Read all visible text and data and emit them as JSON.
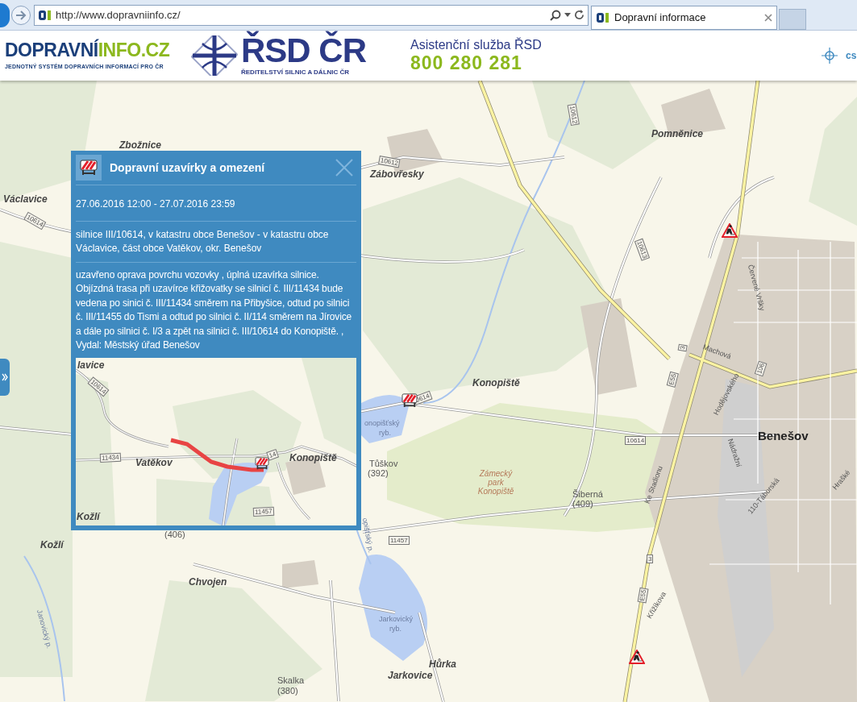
{
  "browser": {
    "address": "http://www.dopravniinfo.cz/",
    "tab_title": "Dopravní informace"
  },
  "header": {
    "logo_dark": "DOPRAVNÍ",
    "logo_light": "INFO.CZ",
    "logo_tagline": "JEDNOTNÝ SYSTÉM DOPRAVNÍCH INFORMACÍ PRO ČR",
    "rsd_title": "ŘSD ČR",
    "rsd_subtitle": "ŘEDITELSTVÍ SILNIC A DÁLNIC ČR",
    "assistance_label": "Asistenční služba ŘSD",
    "assistance_phone": "800 280 281",
    "language": "cs"
  },
  "popup": {
    "title": "Dopravní uzavírky a omezení",
    "date_range": "27.06.2016 12:00 - 27.07.2016 23:59",
    "location": "silnice III/10614, v katastru obce Benešov - v katastru obce Václavice, část obce Vatěkov, okr. Benešov",
    "description": "uzavřeno oprava povrchu vozovky , úplná uzavírka silnice. Objízdná trasa při uzavírce křižovatky se silnicí č. III/11434 bude vedena po sinici č. III/11434 směrem na Přibyšice, odtud po silnici č. III/11455 do Tismi a odtud po silnici č. II/114 směrem na Jírovice a dále po silnici č. I/3 a zpět na silnici č. III/10614 do Konopiště. , Vydal: Městský úřad Benešov",
    "inset_labels": [
      {
        "text": "lavice",
        "kind": "village"
      },
      {
        "text": "10614",
        "kind": "road"
      },
      {
        "text": "11434",
        "kind": "road"
      },
      {
        "text": "Vatěkov",
        "kind": "village"
      },
      {
        "text": "14",
        "kind": "road"
      },
      {
        "text": "Konopiště",
        "kind": "village"
      },
      {
        "text": "Kožlí",
        "kind": "village"
      },
      {
        "text": "11457",
        "kind": "road"
      }
    ]
  },
  "map_labels": [
    {
      "text": "Zbožnice",
      "kind": "village"
    },
    {
      "text": "Václavice",
      "kind": "village"
    },
    {
      "text": "10614",
      "kind": "road"
    },
    {
      "text": "Zábovřesky",
      "kind": "village"
    },
    {
      "text": "10612",
      "kind": "road"
    },
    {
      "text": "10612",
      "kind": "road"
    },
    {
      "text": "Pomněnice",
      "kind": "village"
    },
    {
      "text": "10613",
      "kind": "road"
    },
    {
      "text": "Konopiště",
      "kind": "village"
    },
    {
      "text": "0614",
      "kind": "road"
    },
    {
      "text": "onopišťský",
      "kind": "water"
    },
    {
      "text": "ryb.",
      "kind": "water"
    },
    {
      "text": "Tůškov",
      "kind": "peak"
    },
    {
      "text": "(392)",
      "kind": "peak"
    },
    {
      "text": "Zámecký park Konopiště",
      "kind": "park"
    },
    {
      "text": "Šiberná",
      "kind": "peak"
    },
    {
      "text": "(409)",
      "kind": "peak"
    },
    {
      "text": "10614",
      "kind": "road"
    },
    {
      "text": "Benešov",
      "kind": "town"
    },
    {
      "text": "Machová",
      "kind": "street"
    },
    {
      "text": "Červené Vršky",
      "kind": "street"
    },
    {
      "text": "Hodějovského",
      "kind": "street"
    },
    {
      "text": "E55",
      "kind": "road"
    },
    {
      "text": "3",
      "kind": "road"
    },
    {
      "text": "106",
      "kind": "road"
    },
    {
      "text": "Ke Stadionu",
      "kind": "street"
    },
    {
      "text": "Nádražní",
      "kind": "street"
    },
    {
      "text": "110-Táborská",
      "kind": "street"
    },
    {
      "text": "Hrašké",
      "kind": "street"
    },
    {
      "text": "Křižíkova",
      "kind": "street"
    },
    {
      "text": "E55",
      "kind": "road"
    },
    {
      "text": "3",
      "kind": "road"
    },
    {
      "text": "Kožlí",
      "kind": "village"
    },
    {
      "text": "(406)",
      "kind": "peak"
    },
    {
      "text": "Chvojen",
      "kind": "village"
    },
    {
      "text": "11457",
      "kind": "road"
    },
    {
      "text": "opišťský p.",
      "kind": "water"
    },
    {
      "text": "Janovický p.",
      "kind": "water"
    },
    {
      "text": "Jarkovický",
      "kind": "water"
    },
    {
      "text": "ryb.",
      "kind": "water"
    },
    {
      "text": "Hůrka",
      "kind": "village"
    },
    {
      "text": "Jarkovice",
      "kind": "village"
    },
    {
      "text": "Skalka",
      "kind": "peak"
    },
    {
      "text": "(380)",
      "kind": "peak"
    }
  ],
  "markers": [
    {
      "kind": "closure"
    },
    {
      "kind": "roadwork"
    },
    {
      "kind": "roadwork"
    }
  ]
}
